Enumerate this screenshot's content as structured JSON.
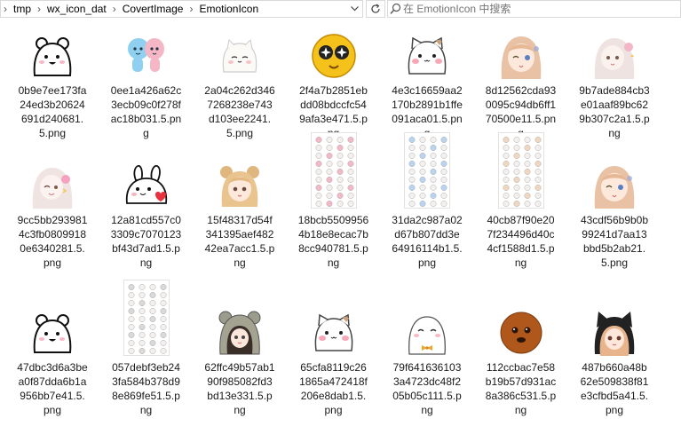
{
  "breadcrumb": {
    "root_arrow": "›",
    "items": [
      "tmp",
      "wx_icon_dat",
      "CovertImage",
      "EmotionIcon"
    ]
  },
  "search": {
    "placeholder": "在 EmotionIcon 中搜索"
  },
  "files": [
    {
      "name": "0b9e7ee173fa24ed3b20624691d240681.5.png",
      "icon": "white-bear-icon"
    },
    {
      "name": "0ee1a426a62c3ecb09c0f278fac18b031.5.png",
      "icon": "blue-pink-couple-icon"
    },
    {
      "name": "2a04c262d3467268238e743d103ee2241.5.png",
      "icon": "white-cat-icon"
    },
    {
      "name": "2f4a7b2851ebdd08bdccfc549afa3e471.5.png",
      "icon": "yellow-star-eyes-icon"
    },
    {
      "name": "4e3c16659aa2170b2891b1ffe091aca01.5.png",
      "icon": "blush-cat-icon"
    },
    {
      "name": "8d12562cda930095c94db6ff170500e11.5.png",
      "icon": "anime-girl-wink-icon"
    },
    {
      "name": "9b7ade884cb3e01aaf89bc629b307c2a1.5.png",
      "icon": "pale-girl-flower-icon"
    },
    {
      "name": "9cc5bb2939814c3fb08099180e6340281.5.png",
      "icon": "pale-girl-wink-icon"
    },
    {
      "name": "12a81cd557c03309c7070123bf43d7ad1.5.png",
      "icon": "white-rabbit-heart-icon"
    },
    {
      "name": "15f48317d54f341395aef48242ea7acc1.5.png",
      "icon": "girl-buns-icon"
    },
    {
      "name": "18bcb55099564b18e8ecac7b8cc940781.5.png",
      "icon": "sticker-sheet-pink-icon"
    },
    {
      "name": "31da2c987a02d67b807dd3e64916114b1.5.png",
      "icon": "sticker-sheet-blue-icon"
    },
    {
      "name": "40cb87f90e207f234496d40c4cf1588d1.5.png",
      "icon": "sticker-sheet-cat-icon"
    },
    {
      "name": "43cdf56b9b0b99241d7aa13bbd5b2ab21.5.png",
      "icon": "anime-girl-wink-icon"
    },
    {
      "name": "47dbc3d6a3bea0f87dda6b1a956bb7e41.5.png",
      "icon": "white-bear-icon"
    },
    {
      "name": "057debf3eb243fa584b378d98e869fe51.5.png",
      "icon": "sticker-sheet-gray-icon"
    },
    {
      "name": "62ffc49b57ab190f985082fd3bd13e331.5.png",
      "icon": "girl-bear-hood-icon"
    },
    {
      "name": "65cfa8119c261865a472418f206e8dab1.5.png",
      "icon": "blush-cat-icon"
    },
    {
      "name": "79f6416361033a4723dc48f205b05c111.5.png",
      "icon": "seal-bow-icon"
    },
    {
      "name": "112ccbac7e58b19b57d931ac8a386c531.5.png",
      "icon": "brown-face-icon"
    },
    {
      "name": "487b660a48b62e509838f81e3cfbd5a41.5.png",
      "icon": "girl-cat-hood-icon"
    }
  ]
}
